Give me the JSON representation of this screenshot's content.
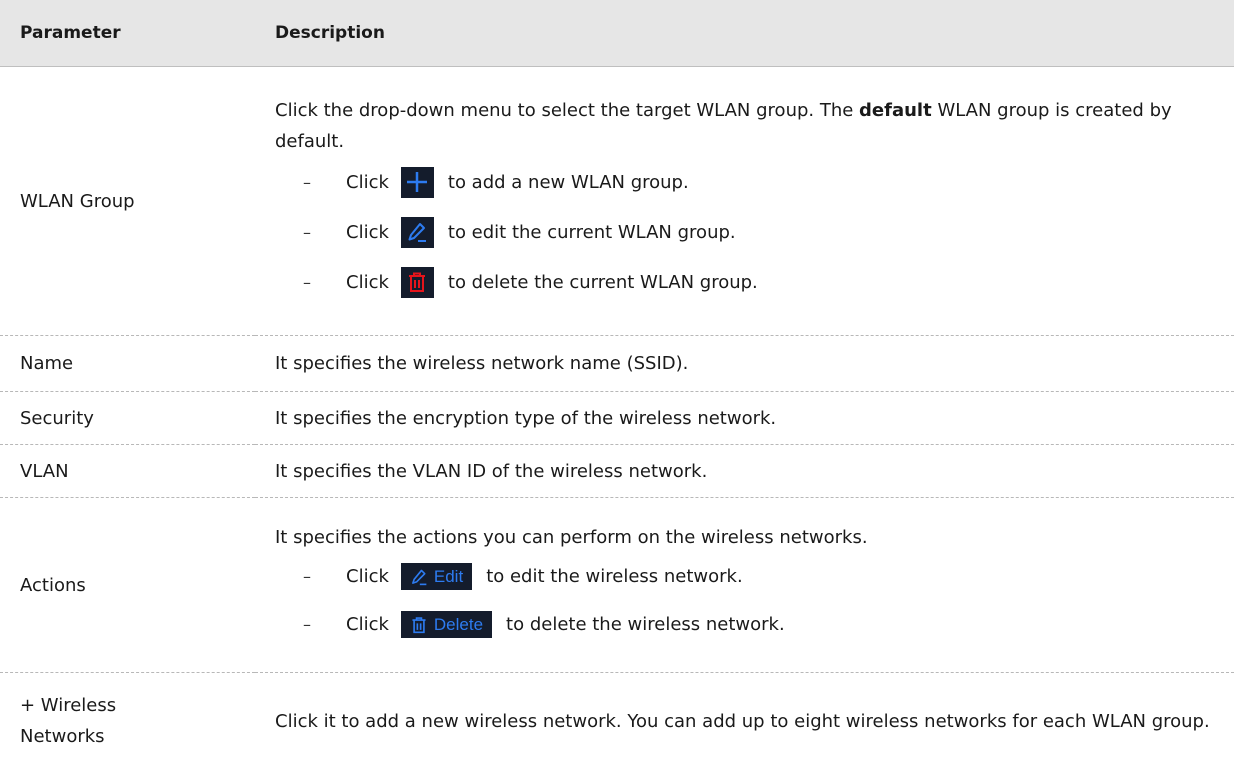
{
  "header": {
    "parameter": "Parameter",
    "description": "Description"
  },
  "rows": {
    "wlan_group": {
      "name": "WLAN Group",
      "intro_before": "Click the drop-down menu to select the target WLAN group. The ",
      "intro_bold": "default",
      "intro_after": " WLAN group is created by default.",
      "bullets": [
        {
          "dash": "–",
          "click": "Click",
          "icon": "plus-icon",
          "text": "to add a new WLAN group."
        },
        {
          "dash": "–",
          "click": "Click",
          "icon": "edit-icon",
          "text": "to edit the current WLAN group."
        },
        {
          "dash": "–",
          "click": "Click",
          "icon": "delete-icon",
          "text": "to delete the current WLAN group."
        }
      ]
    },
    "name": {
      "name": "Name",
      "desc": "It specifies the wireless network name (SSID)."
    },
    "security": {
      "name": "Security",
      "desc": "It specifies the encryption type of the wireless network."
    },
    "vlan": {
      "name": "VLAN",
      "desc": "It specifies the VLAN ID of the wireless network."
    },
    "actions": {
      "name": "Actions",
      "intro": "It specifies the actions you can perform on the wireless networks.",
      "bullets": [
        {
          "dash": "–",
          "click": "Click",
          "icon": "edit-icon",
          "button_label": "Edit",
          "text": "to edit the wireless network."
        },
        {
          "dash": "–",
          "click": "Click",
          "icon": "delete-icon",
          "button_label": "Delete",
          "text": "to delete the wireless network."
        }
      ]
    },
    "wireless_networks": {
      "name_line1": "+ Wireless",
      "name_line2": "Networks",
      "desc": "Click it to add a new wireless network. You can add up to eight wireless networks for each WLAN group."
    }
  },
  "colors": {
    "header_bg": "#e6e6e6",
    "icon_bg": "#141c2c",
    "icon_blue": "#2d7bf0",
    "icon_red": "#e5141b"
  }
}
